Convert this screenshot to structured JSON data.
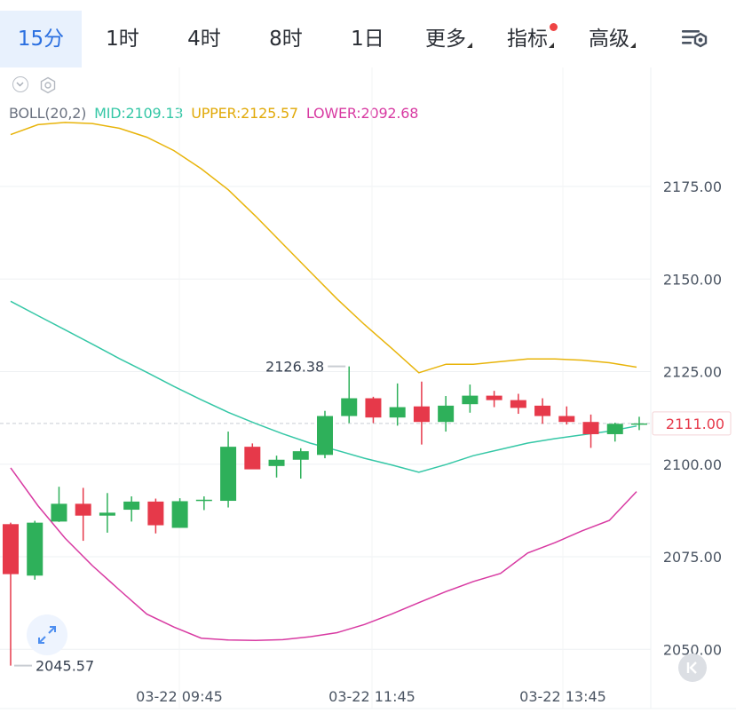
{
  "tabs": [
    {
      "label": "15分",
      "active": true
    },
    {
      "label": "1时",
      "active": false
    },
    {
      "label": "4时",
      "active": false
    },
    {
      "label": "8时",
      "active": false
    },
    {
      "label": "1日",
      "active": false
    },
    {
      "label": "更多",
      "active": false
    },
    {
      "label": "指标",
      "active": false
    },
    {
      "label": "高级",
      "active": false
    }
  ],
  "icons": {
    "collapse": "chevron-down-icon",
    "settings_small": "hexagon-settings-icon",
    "chart_settings": "chart-settings-icon",
    "expand": "expand-icon",
    "back": "back-to-latest-icon"
  },
  "legend": {
    "name": "BOLL(20,2)",
    "mid": "MID:2109.13",
    "upper": "UPPER:2125.57",
    "lower": "LOWER:2092.68"
  },
  "colors": {
    "up": "#2eb05a",
    "down": "#e6394a",
    "mid": "#35c7a6",
    "upper": "#e8b40a",
    "lower": "#d83aa2",
    "accent": "#2a6fe0"
  },
  "chart_data": {
    "type": "candlestick",
    "indicator": "BOLL(20,2)",
    "ylim": [
      2045,
      2190
    ],
    "y_ticks": [
      "2175.00",
      "2150.00",
      "2125.00",
      "2100.00",
      "2075.00",
      "2050.00"
    ],
    "x_labels": [
      "03-22 09:45",
      "03-22 11:45",
      "03-22 13:45"
    ],
    "current_price": "2111.00",
    "high_marker": "2126.38",
    "low_marker": "2045.57",
    "candles": [
      {
        "o": 2083.8,
        "h": 2084.2,
        "l": 2045.6,
        "c": 2070.3
      },
      {
        "o": 2069.9,
        "h": 2084.7,
        "l": 2068.8,
        "c": 2084.2
      },
      {
        "o": 2084.5,
        "h": 2093.9,
        "l": 2084.4,
        "c": 2089.3
      },
      {
        "o": 2089.3,
        "h": 2093.6,
        "l": 2079.3,
        "c": 2086.1
      },
      {
        "o": 2086.1,
        "h": 2092.2,
        "l": 2081.5,
        "c": 2086.9
      },
      {
        "o": 2087.7,
        "h": 2091.3,
        "l": 2084.5,
        "c": 2089.9
      },
      {
        "o": 2089.9,
        "h": 2090.7,
        "l": 2081.3,
        "c": 2083.5
      },
      {
        "o": 2082.8,
        "h": 2090.8,
        "l": 2082.8,
        "c": 2090.0
      },
      {
        "o": 2090.1,
        "h": 2091.3,
        "l": 2087.6,
        "c": 2090.4
      },
      {
        "o": 2090.1,
        "h": 2108.8,
        "l": 2088.3,
        "c": 2104.7
      },
      {
        "o": 2104.7,
        "h": 2105.6,
        "l": 2099.5,
        "c": 2098.6
      },
      {
        "o": 2099.5,
        "h": 2102.3,
        "l": 2096.4,
        "c": 2101.2
      },
      {
        "o": 2101.2,
        "h": 2104.3,
        "l": 2096.1,
        "c": 2103.5
      },
      {
        "o": 2102.5,
        "h": 2114.4,
        "l": 2101.6,
        "c": 2113.0
      },
      {
        "o": 2113.0,
        "h": 2126.4,
        "l": 2111.1,
        "c": 2117.8
      },
      {
        "o": 2117.8,
        "h": 2118.2,
        "l": 2111.1,
        "c": 2112.6
      },
      {
        "o": 2112.6,
        "h": 2121.8,
        "l": 2110.4,
        "c": 2115.4
      },
      {
        "o": 2115.6,
        "h": 2122.3,
        "l": 2105.3,
        "c": 2111.4
      },
      {
        "o": 2111.4,
        "h": 2118.4,
        "l": 2108.8,
        "c": 2115.8
      },
      {
        "o": 2116.2,
        "h": 2121.5,
        "l": 2113.9,
        "c": 2118.5
      },
      {
        "o": 2118.5,
        "h": 2119.8,
        "l": 2115.4,
        "c": 2117.3
      },
      {
        "o": 2117.3,
        "h": 2119.0,
        "l": 2113.6,
        "c": 2115.2
      },
      {
        "o": 2115.8,
        "h": 2117.8,
        "l": 2110.9,
        "c": 2113.0
      },
      {
        "o": 2113.0,
        "h": 2115.6,
        "l": 2110.7,
        "c": 2111.4
      },
      {
        "o": 2111.4,
        "h": 2113.4,
        "l": 2104.4,
        "c": 2108.1
      },
      {
        "o": 2108.1,
        "h": 2111.2,
        "l": 2106.1,
        "c": 2110.9
      },
      {
        "o": 2110.9,
        "h": 2112.8,
        "l": 2109.2,
        "c": 2111.0
      }
    ],
    "boll_upper": [
      2189.0,
      2191.7,
      2192.3,
      2192.0,
      2190.7,
      2188.3,
      2184.7,
      2179.8,
      2174.1,
      2167.0,
      2159.5,
      2152.0,
      2144.6,
      2137.7,
      2131.3,
      2124.7,
      2127.0,
      2127.0,
      2127.7,
      2128.4,
      2128.4,
      2128.1,
      2127.4,
      2126.2
    ],
    "boll_mid": [
      2144.0,
      2140.1,
      2136.3,
      2132.4,
      2128.5,
      2124.8,
      2121.0,
      2117.4,
      2114.0,
      2111.0,
      2108.2,
      2105.7,
      2103.7,
      2101.6,
      2099.8,
      2097.8,
      2099.9,
      2102.3,
      2104.0,
      2105.7,
      2106.9,
      2107.9,
      2108.9,
      2110.3
    ],
    "boll_lower": [
      2099.0,
      2088.8,
      2080.0,
      2072.6,
      2066.0,
      2059.5,
      2056.0,
      2053.0,
      2052.5,
      2052.4,
      2052.6,
      2053.4,
      2054.5,
      2056.7,
      2059.5,
      2062.6,
      2065.6,
      2068.3,
      2070.5,
      2076.0,
      2078.8,
      2082.0,
      2084.8,
      2092.6
    ]
  }
}
